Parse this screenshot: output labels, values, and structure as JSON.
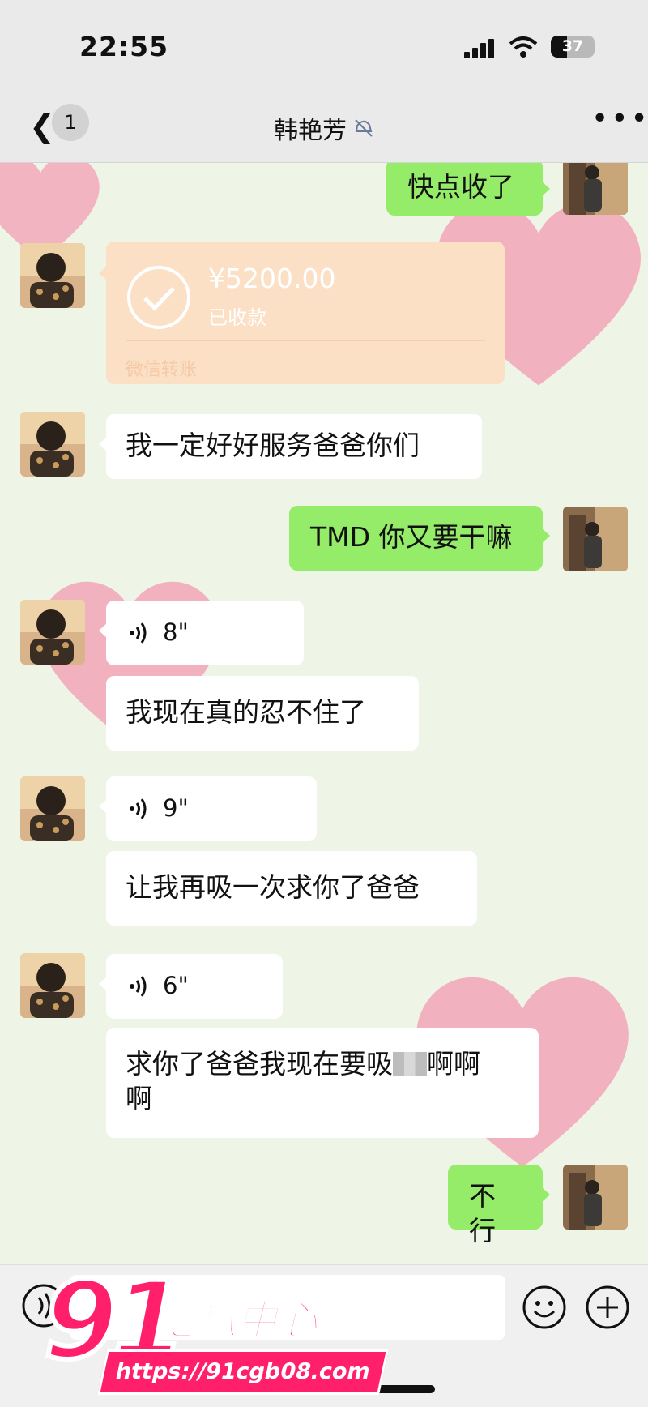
{
  "status_bar": {
    "time": "22:55",
    "battery": "37"
  },
  "nav": {
    "unread_count": "1",
    "title": "韩艳芳"
  },
  "messages": [
    {
      "dir": "out",
      "type": "text",
      "text": "快点收了"
    },
    {
      "dir": "in",
      "type": "transfer",
      "amount": "¥5200.00",
      "status": "已收款",
      "label": "微信转账"
    },
    {
      "dir": "in",
      "type": "text",
      "text": "我一定好好服务爸爸你们"
    },
    {
      "dir": "out",
      "type": "text",
      "text": "TMD 你又要干嘛"
    },
    {
      "dir": "in",
      "type": "voice",
      "duration": "8\""
    },
    {
      "dir": "in",
      "type": "text",
      "text": "我现在真的忍不住了"
    },
    {
      "dir": "in",
      "type": "voice",
      "duration": "9\""
    },
    {
      "dir": "in",
      "type": "text",
      "text": "让我再吸一次求你了爸爸"
    },
    {
      "dir": "in",
      "type": "voice",
      "duration": "6\""
    },
    {
      "dir": "in",
      "type": "text",
      "text_before": "求你了爸爸我现在要吸",
      "text_after": "啊啊",
      "text_line2": "啊"
    },
    {
      "dir": "out",
      "type": "text",
      "text": "不行"
    }
  ],
  "watermark": {
    "logo": "91",
    "title": "吃瓜中心",
    "url": "https://91cgb08.com"
  },
  "colors": {
    "outgoing_bubble": "#95ec69",
    "incoming_bubble": "#ffffff",
    "transfer_card": "#fbe0c6",
    "watermark": "#ff1f6b"
  }
}
